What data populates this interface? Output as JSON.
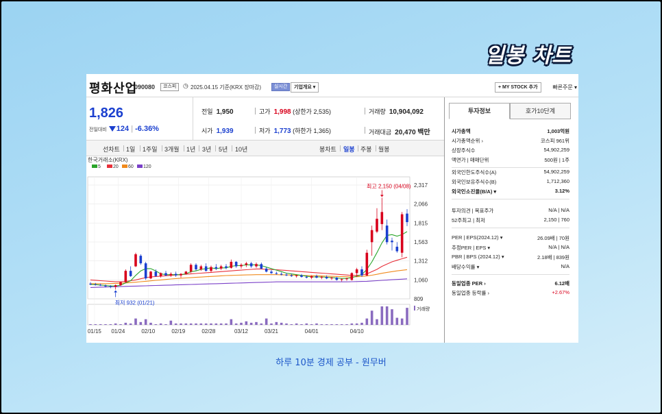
{
  "headline": "일봉 차트",
  "caption": "하루 10분 경제 공부 - 원무버",
  "header": {
    "company": "평화산업",
    "code": "090080",
    "market_tag": "코스피",
    "date_label": "2025.04.15 기준(KRX 장마감)",
    "realtime_tag": "실시간",
    "company_info_button": "기업개요 ▾",
    "mystock_button": "+ MY STOCK 추가",
    "quick_order": "빠른주문 ▾"
  },
  "quote": {
    "price": "1,826",
    "change_label": "전일대비",
    "change": "124",
    "change_pct": "-6.36%",
    "prev_close_label": "전일",
    "prev_close": "1,950",
    "open_label": "시가",
    "open": "1,939",
    "high_label": "고가",
    "high": "1,998",
    "upper_limit": "(상한가 2,535)",
    "low_label": "저가",
    "low": "1,773",
    "lower_limit": "(하한가 1,365)",
    "volume_label": "거래량",
    "volume": "10,904,092",
    "amount_label": "거래대금",
    "amount": "20,470",
    "amount_unit": "백만"
  },
  "periods": [
    "선차트",
    "1일",
    "1주일",
    "3개월",
    "1년",
    "3년",
    "5년",
    "10년"
  ],
  "chart_types": [
    "봉차트",
    "일봉",
    "주봉",
    "월봉"
  ],
  "selected_chart_type": "일봉",
  "colors": {
    "up": "#d8001b",
    "down": "#1a3fcf",
    "ma5": "#2aa52a",
    "ma20": "#e8303a",
    "ma60": "#f08a1c",
    "ma120": "#7a40c8"
  },
  "chart_data": {
    "type": "candlestick",
    "source_label": "한국거래소(KRX)",
    "legend": [
      "5",
      "20",
      "60",
      "120"
    ],
    "y_ticks": [
      "2,317",
      "2,066",
      "1,815",
      "1,563",
      "1,312",
      "1,060",
      "809"
    ],
    "ylim": [
      809,
      2317
    ],
    "x_ticks": [
      "01/15",
      "01/24",
      "02/10",
      "02/19",
      "02/28",
      "03/12",
      "03/21",
      "04/01",
      "04/10"
    ],
    "high_annotation": "최고 2,150 (04/08)",
    "low_annotation": "최저 932 (01/21)",
    "volume_label": "거래량",
    "candles": [
      {
        "o": 1010,
        "h": 1030,
        "l": 990,
        "c": 1000
      },
      {
        "o": 1000,
        "h": 1020,
        "l": 985,
        "c": 995
      },
      {
        "o": 995,
        "h": 1010,
        "l": 980,
        "c": 985
      },
      {
        "o": 985,
        "h": 1000,
        "l": 960,
        "c": 975
      },
      {
        "o": 975,
        "h": 990,
        "l": 950,
        "c": 970
      },
      {
        "o": 970,
        "h": 1000,
        "l": 932,
        "c": 990
      },
      {
        "o": 990,
        "h": 1040,
        "l": 980,
        "c": 1030
      },
      {
        "o": 1030,
        "h": 1200,
        "l": 1020,
        "c": 1180
      },
      {
        "o": 1180,
        "h": 1240,
        "l": 1100,
        "c": 1110
      },
      {
        "o": 1240,
        "h": 1420,
        "l": 1230,
        "c": 1400
      },
      {
        "o": 1380,
        "h": 1400,
        "l": 1260,
        "c": 1280
      },
      {
        "o": 1280,
        "h": 1300,
        "l": 1060,
        "c": 1080
      },
      {
        "o": 1080,
        "h": 1180,
        "l": 1070,
        "c": 1170
      },
      {
        "o": 1170,
        "h": 1200,
        "l": 1100,
        "c": 1110
      },
      {
        "o": 1110,
        "h": 1160,
        "l": 1090,
        "c": 1150
      },
      {
        "o": 1150,
        "h": 1180,
        "l": 1110,
        "c": 1120
      },
      {
        "o": 1120,
        "h": 1160,
        "l": 1100,
        "c": 1140
      },
      {
        "o": 1140,
        "h": 1170,
        "l": 1100,
        "c": 1120
      },
      {
        "o": 1120,
        "h": 1150,
        "l": 1090,
        "c": 1140
      },
      {
        "o": 1140,
        "h": 1180,
        "l": 1130,
        "c": 1170
      },
      {
        "o": 1170,
        "h": 1280,
        "l": 1150,
        "c": 1260
      },
      {
        "o": 1260,
        "h": 1280,
        "l": 1180,
        "c": 1200
      },
      {
        "o": 1200,
        "h": 1260,
        "l": 1180,
        "c": 1240
      },
      {
        "o": 1240,
        "h": 1280,
        "l": 1170,
        "c": 1180
      },
      {
        "o": 1180,
        "h": 1250,
        "l": 1160,
        "c": 1230
      },
      {
        "o": 1230,
        "h": 1270,
        "l": 1190,
        "c": 1210
      },
      {
        "o": 1210,
        "h": 1260,
        "l": 1190,
        "c": 1240
      },
      {
        "o": 1240,
        "h": 1270,
        "l": 1200,
        "c": 1220
      },
      {
        "o": 1220,
        "h": 1330,
        "l": 1210,
        "c": 1300
      },
      {
        "o": 1300,
        "h": 1310,
        "l": 1220,
        "c": 1240
      },
      {
        "o": 1240,
        "h": 1280,
        "l": 1210,
        "c": 1260
      },
      {
        "o": 1260,
        "h": 1300,
        "l": 1230,
        "c": 1280
      },
      {
        "o": 1280,
        "h": 1300,
        "l": 1220,
        "c": 1240
      },
      {
        "o": 1240,
        "h": 1290,
        "l": 1220,
        "c": 1270
      },
      {
        "o": 1270,
        "h": 1290,
        "l": 1200,
        "c": 1210
      },
      {
        "o": 1210,
        "h": 1230,
        "l": 1160,
        "c": 1170
      },
      {
        "o": 1170,
        "h": 1190,
        "l": 1140,
        "c": 1150
      },
      {
        "o": 1150,
        "h": 1170,
        "l": 1130,
        "c": 1140
      },
      {
        "o": 1140,
        "h": 1160,
        "l": 1120,
        "c": 1130
      },
      {
        "o": 1130,
        "h": 1150,
        "l": 1110,
        "c": 1120
      },
      {
        "o": 1120,
        "h": 1140,
        "l": 1100,
        "c": 1110
      },
      {
        "o": 1110,
        "h": 1130,
        "l": 1090,
        "c": 1120
      },
      {
        "o": 1120,
        "h": 1140,
        "l": 1090,
        "c": 1100
      },
      {
        "o": 1100,
        "h": 1120,
        "l": 1080,
        "c": 1090
      },
      {
        "o": 1090,
        "h": 1120,
        "l": 1070,
        "c": 1110
      },
      {
        "o": 1110,
        "h": 1130,
        "l": 1080,
        "c": 1090
      },
      {
        "o": 1090,
        "h": 1110,
        "l": 1070,
        "c": 1100
      },
      {
        "o": 1100,
        "h": 1120,
        "l": 1070,
        "c": 1080
      },
      {
        "o": 1080,
        "h": 1100,
        "l": 1060,
        "c": 1090
      },
      {
        "o": 1090,
        "h": 1100,
        "l": 1050,
        "c": 1060
      },
      {
        "o": 1060,
        "h": 1080,
        "l": 1040,
        "c": 1070
      },
      {
        "o": 1070,
        "h": 1090,
        "l": 1050,
        "c": 1080
      },
      {
        "o": 1060,
        "h": 1160,
        "l": 1050,
        "c": 1150
      },
      {
        "o": 1150,
        "h": 1220,
        "l": 1100,
        "c": 1200
      },
      {
        "o": 1200,
        "h": 1240,
        "l": 1100,
        "c": 1120
      },
      {
        "o": 1120,
        "h": 1460,
        "l": 1110,
        "c": 1420
      },
      {
        "o": 1560,
        "h": 1780,
        "l": 1380,
        "c": 1720
      },
      {
        "o": 1700,
        "h": 2010,
        "l": 1680,
        "c": 1870
      },
      {
        "o": 1800,
        "h": 2150,
        "l": 1720,
        "c": 1960
      },
      {
        "o": 1780,
        "h": 1860,
        "l": 1530,
        "c": 1560
      },
      {
        "o": 1580,
        "h": 1620,
        "l": 1450,
        "c": 1560
      },
      {
        "o": 1500,
        "h": 1560,
        "l": 1420,
        "c": 1440
      },
      {
        "o": 1420,
        "h": 1960,
        "l": 1360,
        "c": 1930
      },
      {
        "o": 1939,
        "h": 1998,
        "l": 1773,
        "c": 1826
      }
    ],
    "ma5": [
      1000,
      998,
      992,
      986,
      980,
      980,
      990,
      1020,
      1050,
      1120,
      1180,
      1210,
      1210,
      1180,
      1140,
      1130,
      1130,
      1130,
      1130,
      1140,
      1170,
      1180,
      1200,
      1210,
      1220,
      1210,
      1220,
      1220,
      1240,
      1250,
      1250,
      1260,
      1260,
      1260,
      1250,
      1230,
      1210,
      1190,
      1170,
      1150,
      1140,
      1130,
      1120,
      1110,
      1100,
      1100,
      1100,
      1095,
      1090,
      1085,
      1080,
      1080,
      1090,
      1110,
      1130,
      1200,
      1300,
      1420,
      1550,
      1650,
      1660,
      1640,
      1660,
      1700
    ],
    "ma20": [
      1060,
      1055,
      1050,
      1045,
      1040,
      1035,
      1035,
      1040,
      1050,
      1060,
      1075,
      1090,
      1100,
      1105,
      1110,
      1115,
      1120,
      1125,
      1130,
      1135,
      1140,
      1145,
      1150,
      1155,
      1160,
      1165,
      1170,
      1175,
      1180,
      1185,
      1190,
      1195,
      1200,
      1205,
      1205,
      1200,
      1198,
      1195,
      1190,
      1185,
      1180,
      1175,
      1170,
      1165,
      1160,
      1155,
      1150,
      1145,
      1140,
      1135,
      1130,
      1125,
      1120,
      1120,
      1125,
      1140,
      1170,
      1200,
      1240,
      1270,
      1300,
      1320,
      1340,
      1360
    ],
    "ma60": [
      1010,
      1010,
      1010,
      1010,
      1012,
      1014,
      1016,
      1020,
      1024,
      1030,
      1036,
      1042,
      1048,
      1054,
      1060,
      1066,
      1072,
      1078,
      1082,
      1086,
      1090,
      1094,
      1098,
      1102,
      1106,
      1110,
      1114,
      1118,
      1120,
      1122,
      1124,
      1126,
      1128,
      1130,
      1130,
      1130,
      1130,
      1130,
      1128,
      1126,
      1124,
      1122,
      1120,
      1118,
      1116,
      1114,
      1112,
      1110,
      1108,
      1106,
      1104,
      1102,
      1100,
      1102,
      1106,
      1112,
      1122,
      1134,
      1148,
      1160,
      1170,
      1180,
      1188,
      1196
    ],
    "ma120": [
      960,
      962,
      964,
      966,
      968,
      970,
      972,
      974,
      976,
      978,
      980,
      982,
      984,
      986,
      988,
      990,
      992,
      994,
      996,
      998,
      1000,
      1002,
      1004,
      1006,
      1008,
      1010,
      1012,
      1014,
      1016,
      1018,
      1020,
      1022,
      1024,
      1026,
      1028,
      1030,
      1032,
      1034,
      1034,
      1034,
      1034,
      1034,
      1034,
      1034,
      1034,
      1034,
      1034,
      1034,
      1034,
      1034,
      1034,
      1034,
      1036,
      1038,
      1040,
      1042,
      1046,
      1050,
      1054,
      1058,
      1062,
      1066,
      1070,
      1074
    ],
    "volume": [
      1,
      1,
      1,
      1,
      1,
      2,
      1,
      3,
      2,
      9,
      4,
      8,
      3,
      1,
      2,
      1,
      6,
      2,
      2,
      2,
      2,
      2,
      2,
      2,
      2,
      2,
      2,
      2,
      8,
      2,
      3,
      5,
      3,
      4,
      2,
      9,
      2,
      4,
      3,
      2,
      1,
      2,
      1,
      2,
      1,
      2,
      1,
      1,
      1,
      1,
      1,
      1,
      2,
      2,
      3,
      9,
      20,
      8,
      26,
      26,
      22,
      10,
      9,
      24
    ]
  },
  "info": {
    "tabs": [
      "투자정보",
      "호가10단계"
    ],
    "rows1": [
      {
        "k": "시가총액",
        "v": "1,003억원",
        "bold": true
      },
      {
        "k": "시가총액순위 ›",
        "v": "코스피 961위"
      },
      {
        "k": "상장주식수",
        "v": "54,902,259"
      },
      {
        "k": "액면가 | 매매단위",
        "v": "500원 | 1주"
      }
    ],
    "rows2": [
      {
        "k": "외국인한도주식수(A)",
        "v": "54,902,259"
      },
      {
        "k": "외국인보유주식수(B)",
        "v": "1,712,360"
      },
      {
        "k": "외국인소진율(B/A) ▾",
        "v": "3.12%",
        "bold": true
      }
    ],
    "rows3": [
      {
        "k": "투자의견 | 목표주가",
        "v": "N/A | N/A"
      },
      {
        "k": "52주최고 | 최저",
        "v": "2,150 | 760"
      }
    ],
    "rows4": [
      {
        "k": "PER | EPS(2024.12) ▾",
        "v": "26.09배 | 70원"
      },
      {
        "k": "추정PER | EPS ▾",
        "v": "N/A | N/A"
      },
      {
        "k": "PBR | BPS (2024.12) ▾",
        "v": "2.18배 | 839원"
      },
      {
        "k": "배당수익률 ▾",
        "v": "N/A"
      }
    ],
    "rows5": [
      {
        "k": "동일업종 PER ›",
        "v": "6.12배",
        "bold": true
      },
      {
        "k": "동일업종 등락률 ›",
        "v": "+2.67%",
        "red": true
      }
    ]
  }
}
